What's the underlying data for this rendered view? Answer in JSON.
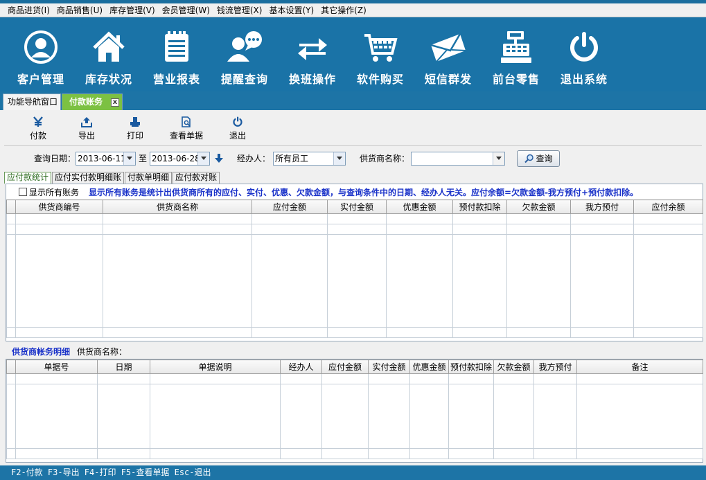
{
  "menu": [
    "商品进货(I)",
    "商品销售(U)",
    "库存管理(V)",
    "会员管理(W)",
    "钱流管理(X)",
    "基本设置(Y)",
    "其它操作(Z)"
  ],
  "iconbar": [
    {
      "label": "客户管理",
      "icon": "user-circle-icon"
    },
    {
      "label": "库存状况",
      "icon": "home-icon"
    },
    {
      "label": "营业报表",
      "icon": "report-icon"
    },
    {
      "label": "提醒查询",
      "icon": "reminder-chat-icon"
    },
    {
      "label": "换班操作",
      "icon": "swap-arrows-icon"
    },
    {
      "label": "软件购买",
      "icon": "cart-icon"
    },
    {
      "label": "短信群发",
      "icon": "envelope-icon"
    },
    {
      "label": "前台零售",
      "icon": "cash-register-icon"
    },
    {
      "label": "退出系统",
      "icon": "power-icon"
    }
  ],
  "tabs": {
    "nav": "功能导航窗口",
    "pay": "付款账务",
    "close": "x"
  },
  "toolbar": [
    {
      "label": "付款",
      "icon": "yen-icon"
    },
    {
      "label": "导出",
      "icon": "export-icon"
    },
    {
      "label": "打印",
      "icon": "print-icon"
    },
    {
      "label": "查看单据",
      "icon": "view-document-icon"
    },
    {
      "label": "退出",
      "icon": "power-icon"
    }
  ],
  "filter": {
    "date_label": "查询日期：",
    "date_from": "2013-06-11",
    "to_label": "至",
    "date_to": "2013-06-28",
    "handler_label": "经办人：",
    "handler_value": "所有员工",
    "supplier_label": "供货商名称：",
    "supplier_value": "",
    "search_button": "查询"
  },
  "subtabs": [
    "应付款统计",
    "应付实付款明细账",
    "付款单明细",
    "应付款对账"
  ],
  "summary": {
    "show_all_label": "显示所有账务",
    "note": "显示所有账务是统计出供货商所有的应付、实付、优惠、欠款金额，与查询条件中的日期、经办人无关。应付余额=欠款金额-我方预付+预付款扣除。",
    "columns": [
      "供货商编号",
      "供货商名称",
      "应付金额",
      "实付金额",
      "优惠金额",
      "预付款扣除",
      "欠款金额",
      "我方预付",
      "应付余额"
    ]
  },
  "detail": {
    "title": "供货商帐务明细",
    "supplier_label": "供货商名称：",
    "columns": [
      "单据号",
      "日期",
      "单据说明",
      "经办人",
      "应付金额",
      "实付金额",
      "优惠金额",
      "预付款扣除",
      "欠款金额",
      "我方预付",
      "备注"
    ]
  },
  "statusbar": "F2-付款 F3-导出 F4-打印 F5-查看单据 Esc-退出",
  "colors": {
    "accent_blue": "#1a73a7",
    "tab_green": "#7cc142",
    "note_blue": "#1a32c9"
  }
}
